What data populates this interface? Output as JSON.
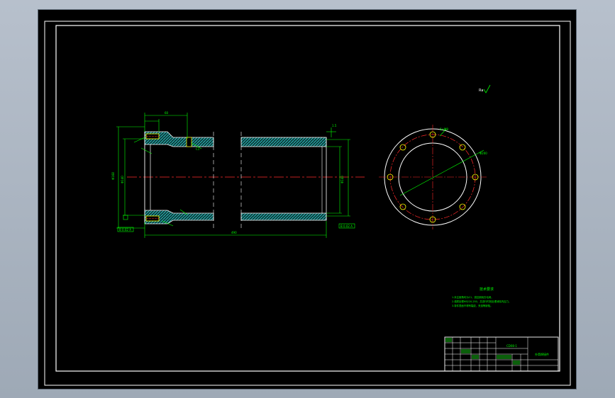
{
  "drawing": {
    "roughness_symbol": "Ra",
    "dimensions": {
      "overall_length": "490",
      "outer_diameter": "Φ168",
      "inner_diameter_left": "Φ140",
      "inner_diameter_right": "Φ140",
      "flange_height": "60",
      "small_gap": "1.5",
      "datum_left": "B 0.02 A",
      "datum_right": "B 0.02 A",
      "chamfer_note": "C1",
      "hole_pattern": "6×M8",
      "bolt_circle": "Φ200"
    },
    "technical_requirements": {
      "title": "技术要求",
      "lines": [
        "1.未注倒角均为C1，锐边倒钝去毛刺。",
        "2.调质处理HB220-250，并进行时效处理消除内应力。",
        "3.零件表面不得有裂纹、夹渣等缺陷。"
      ]
    },
    "title_block": {
      "drawing_number": "CD08-1",
      "part_name": "外筒焊接件",
      "scale": "1:1",
      "material": "45"
    }
  }
}
